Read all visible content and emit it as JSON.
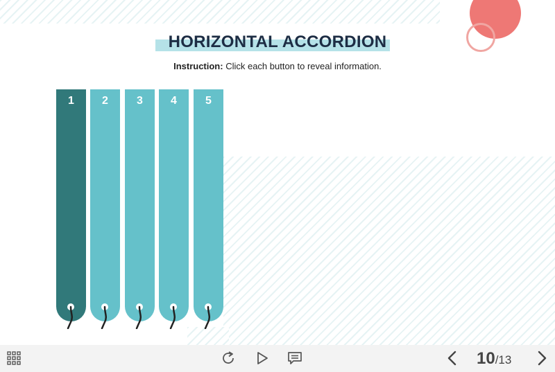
{
  "title": "HORIZONTAL ACCORDION",
  "instruction": {
    "label": "Instruction:",
    "text": " Click each button to reveal information."
  },
  "panels": [
    {
      "label": "1",
      "active": true
    },
    {
      "label": "2",
      "active": false
    },
    {
      "label": "3",
      "active": false
    },
    {
      "label": "4",
      "active": false
    },
    {
      "label": "5",
      "active": false
    }
  ],
  "pager": {
    "current": "10",
    "total": "/13"
  },
  "colors": {
    "panel": "#65c1ca",
    "panel_active": "#31797a",
    "title": "#1d2d44",
    "accent_coral": "#ee7875",
    "title_highlight": "#b5e2e8"
  },
  "icons": {
    "menu": "grid-menu-icon",
    "replay": "replay-icon",
    "play": "play-icon",
    "notes": "notes-icon",
    "prev": "chevron-left-icon",
    "next": "chevron-right-icon"
  }
}
